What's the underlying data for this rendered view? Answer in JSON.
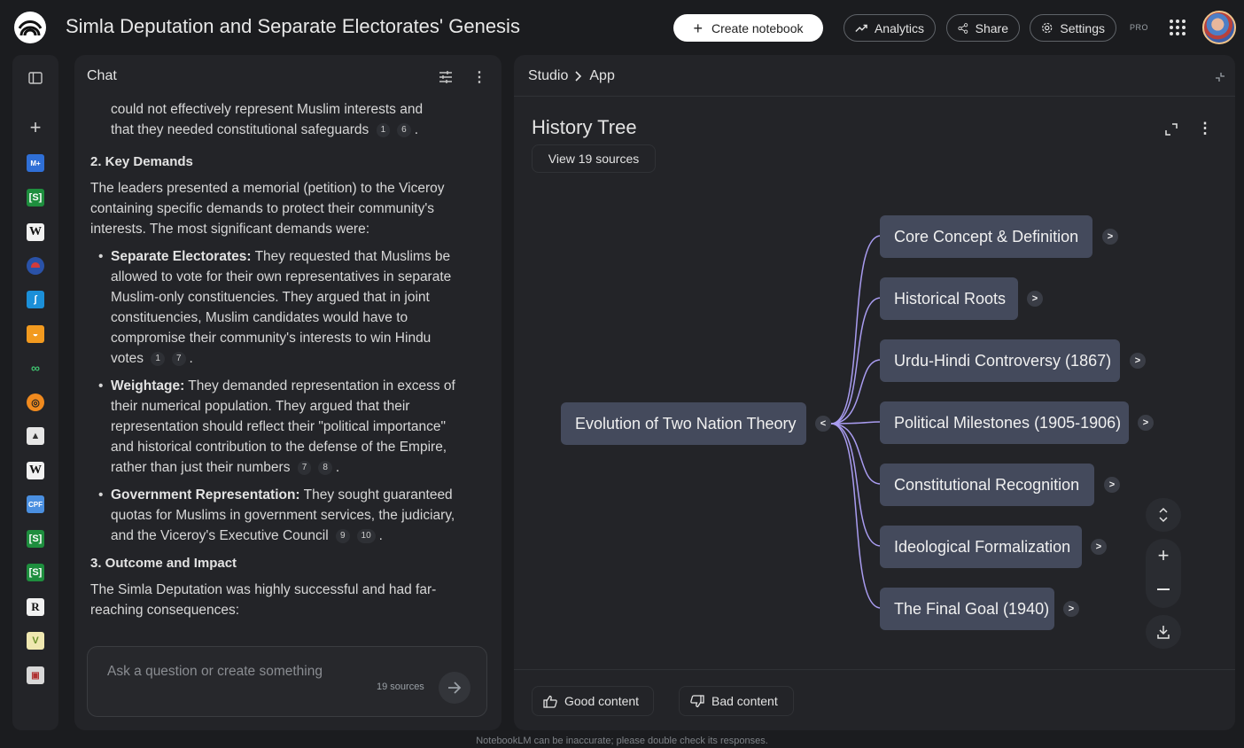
{
  "app": {
    "title": "Simla Deputation and Separate Electorates' Genesis",
    "disclaimer": "NotebookLM can be inaccurate; please double check its responses."
  },
  "topbar": {
    "create_label": "Create notebook",
    "analytics_label": "Analytics",
    "share_label": "Share",
    "settings_label": "Settings",
    "pro_badge": "PRO"
  },
  "rail": {
    "icons": [
      "panel-toggle-icon",
      "add-source-icon",
      "source-file-icon",
      "sheets-source-icon",
      "wikipedia-source-icon",
      "globe-source-icon",
      "blue-source-icon",
      "orange-source-icon",
      "green-source-icon",
      "orange-circle-source-icon",
      "image-source-icon",
      "wikipedia-source-icon",
      "pdf-source-icon",
      "sheets-source-icon",
      "sheets-source-icon",
      "r-source-icon",
      "v-source-icon",
      "doc-source-icon"
    ]
  },
  "chat": {
    "header": "Chat",
    "intro_lines": [
      "could not effectively represent Muslim interests and",
      "that they needed constitutional safeguards"
    ],
    "intro_cites": [
      "1",
      "6"
    ],
    "section2_title": "2. Key Demands",
    "section2_text": "The leaders presented a memorial (petition) to the Viceroy containing specific demands to protect their community's interests. The most significant demands were:",
    "bullets": [
      {
        "title": "Separate Electorates:",
        "text": "They requested that Muslims be allowed to vote for their own representatives in separate Muslim-only constituencies. They argued that in joint constituencies, Muslim candidates would have to compromise their community's interests to win Hindu votes",
        "cites": [
          "1",
          "7"
        ]
      },
      {
        "title": "Weightage:",
        "text": "They demanded representation in excess of their numerical population. They argued that their representation should reflect their \"political importance\" and historical contribution to the defense of the Empire, rather than just their numbers",
        "cites": [
          "7",
          "8"
        ]
      },
      {
        "title": "Government Representation:",
        "text": "They sought guaranteed quotas for Muslims in government services, the judiciary, and the Viceroy's Executive Council",
        "cites": [
          "9",
          "10"
        ]
      }
    ],
    "section3_title": "3. Outcome and Impact",
    "section3_text": "The Simla Deputation was highly successful and had far-reaching consequences:",
    "input_placeholder": "Ask a question or create something",
    "sources_count": "19 sources"
  },
  "studio": {
    "breadcrumb": [
      "Studio",
      "App"
    ],
    "title": "History Tree",
    "view_sources": "View 19 sources",
    "root_node": "Evolution of Two Nation Theory",
    "root_toggle": "<",
    "child_toggle": ">",
    "children": [
      "Core Concept & Definition",
      "Historical Roots",
      "Urdu-Hindi Controversy (1867)",
      "Political Milestones (1905-1906)",
      "Constitutional Recognition",
      "Ideological Formalization",
      "The Final Goal (1940)"
    ],
    "good_label": "Good content",
    "bad_label": "Bad content"
  },
  "colors": {
    "accent_link": "#a99cf0",
    "node_bg": "#444a5c",
    "panel_bg": "#232428",
    "page_bg": "#1b1c1f"
  }
}
